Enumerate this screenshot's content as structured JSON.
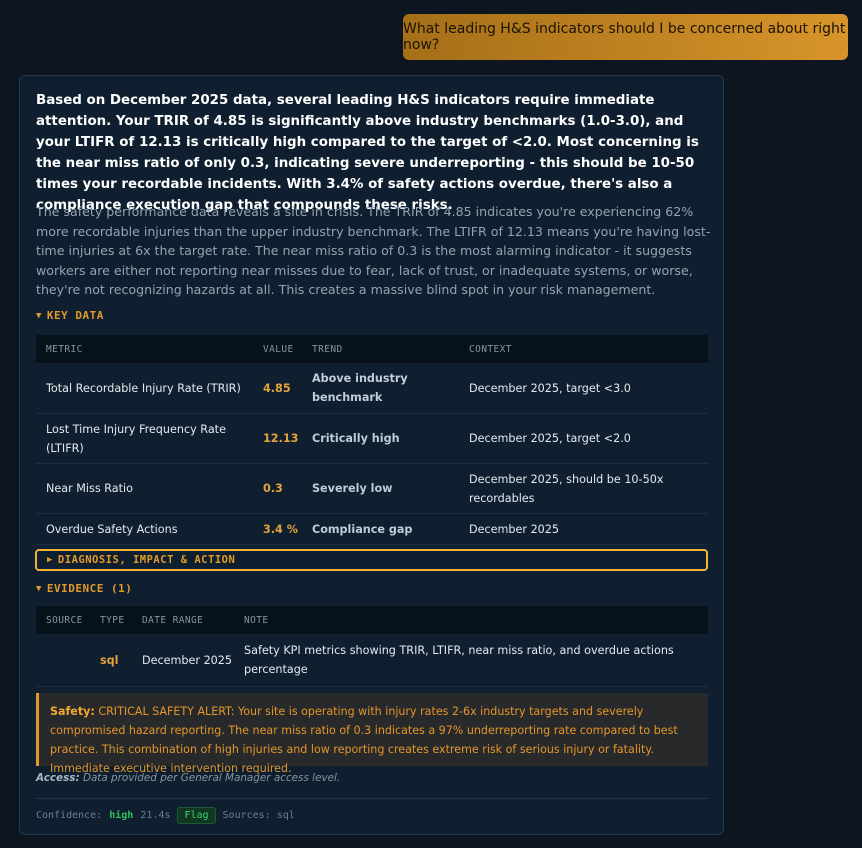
{
  "user_message": "What leading H&S indicators should I be concerned about right now?",
  "answer": {
    "summary": "Based on December 2025 data, several leading H&S indicators require immediate attention. Your TRIR of 4.85 is significantly above industry benchmarks (1.0-3.0), and your LTIFR of 12.13 is critically high compared to the target of <2.0. Most concerning is the near miss ratio of only 0.3, indicating severe underreporting - this should be 10-50 times your recordable incidents. With 3.4% of safety actions overdue, there's also a compliance execution gap that compounds these risks.",
    "detail": "The safety performance data reveals a site in crisis. The TRIR of 4.85 indicates you're experiencing 62% more recordable injuries than the upper industry benchmark. The LTIFR of 12.13 means you're having lost-time injuries at 6x the target rate. The near miss ratio of 0.3 is the most alarming indicator - it suggests workers are either not reporting near misses due to fear, lack of trust, or inadequate systems, or worse, they're not recognizing hazards at all. This creates a massive blind spot in your risk management.",
    "key_data": {
      "label": "KEY DATA",
      "headers": [
        "METRIC",
        "VALUE",
        "TREND",
        "CONTEXT"
      ],
      "rows": [
        {
          "metric": "Total Recordable Injury Rate (TRIR)",
          "value": "4.85",
          "trend": "Above industry benchmark",
          "context": "December 2025, target <3.0"
        },
        {
          "metric": "Lost Time Injury Frequency Rate (LTIFR)",
          "value": "12.13",
          "trend": "Critically high",
          "context": "December 2025, target <2.0"
        },
        {
          "metric": "Near Miss Ratio",
          "value": "0.3",
          "trend": "Severely low",
          "context": "December 2025, should be 10-50x recordables"
        },
        {
          "metric": "Overdue Safety Actions",
          "value": "3.4 %",
          "trend": "Compliance gap",
          "context": "December 2025"
        }
      ]
    },
    "diagnosis_label": "DIAGNOSIS, IMPACT & ACTION",
    "evidence": {
      "label": "EVIDENCE (1)",
      "headers": [
        "SOURCE",
        "TYPE",
        "DATE RANGE",
        "NOTE"
      ],
      "rows": [
        {
          "source": "",
          "type": "sql",
          "date_range": "December 2025",
          "note": "Safety KPI metrics showing TRIR, LTIFR, near miss ratio, and overdue actions percentage"
        }
      ]
    },
    "alert": {
      "label": "Safety:",
      "text": "CRITICAL SAFETY ALERT: Your site is operating with injury rates 2-6x industry targets and severely compromised hazard reporting. The near miss ratio of 0.3 indicates a 97% underreporting rate compared to best practice. This combination of high injuries and low reporting creates extreme risk of serious injury or fatality. Immediate executive intervention required."
    },
    "access": {
      "label": "Access:",
      "text": "Data provided per General Manager access level."
    },
    "footer": {
      "confidence_label": "Confidence:",
      "confidence_value": "high",
      "duration": "21.4s",
      "flag_label": "Flag",
      "sources": "Sources: sql"
    }
  },
  "colors": {
    "accent": "#e19a2a",
    "background": "#0c1520",
    "card": "#0f1f2f",
    "success": "#32c15a"
  },
  "icons": {
    "expanded": "caret-down-icon",
    "collapsed": "caret-right-icon"
  }
}
